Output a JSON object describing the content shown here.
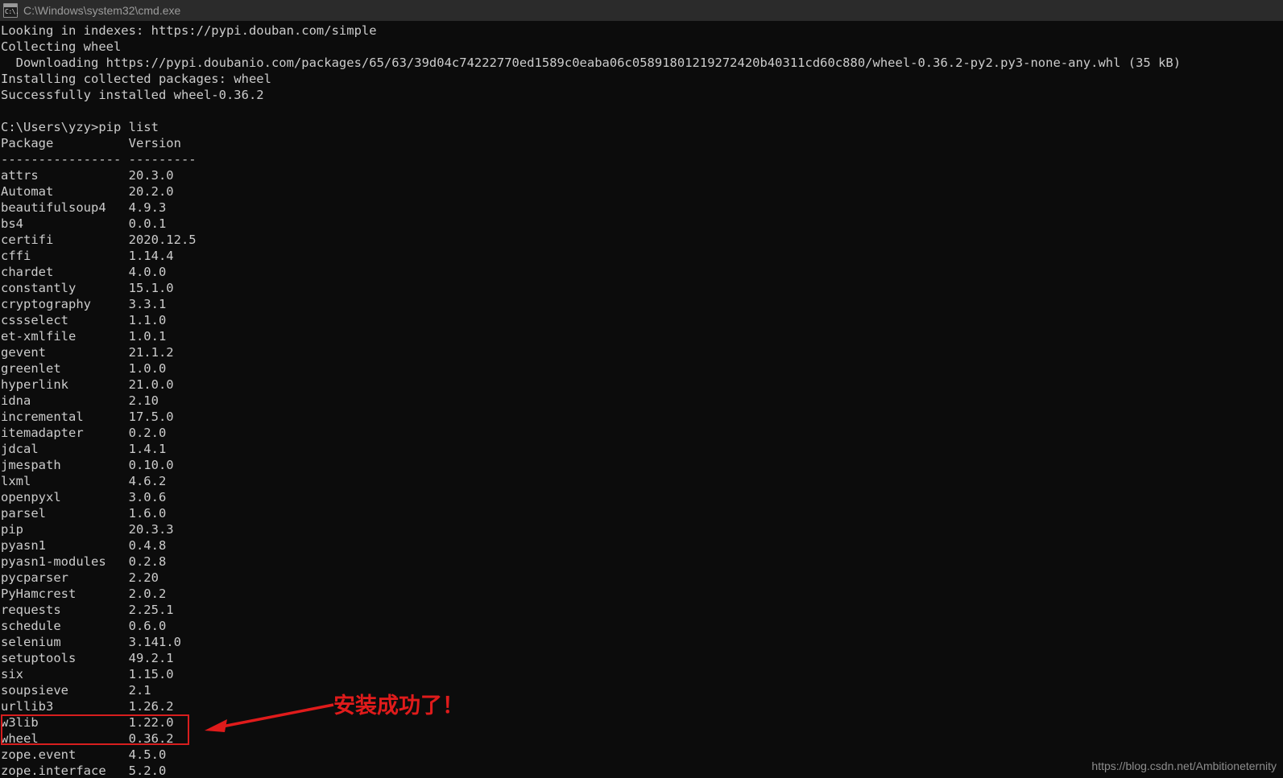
{
  "window": {
    "title": "C:\\Windows\\system32\\cmd.exe",
    "icon_name": "cmd-console-icon",
    "icon_glyph": "C:\\.",
    "titlebar_color": "#2b2b2b",
    "background_color": "#0c0c0c",
    "text_color": "#cccccc"
  },
  "terminal": {
    "install_output": [
      "Looking in indexes: https://pypi.douban.com/simple",
      "Collecting wheel",
      "  Downloading https://pypi.doubanio.com/packages/65/63/39d04c74222770ed1589c0eaba06c05891801219272420b40311cd60c880/wheel-0.36.2-py2.py3-none-any.whl (35 kB)",
      "Installing collected packages: wheel",
      "Successfully installed wheel-0.36.2"
    ],
    "prompt_line": "C:\\Users\\yzy>pip list",
    "header_line": "Package          Version",
    "separator_line": "---------------- ---------",
    "columns": [
      "Package",
      "Version"
    ],
    "packages": [
      {
        "name": "attrs",
        "version": "20.3.0"
      },
      {
        "name": "Automat",
        "version": "20.2.0"
      },
      {
        "name": "beautifulsoup4",
        "version": "4.9.3"
      },
      {
        "name": "bs4",
        "version": "0.0.1"
      },
      {
        "name": "certifi",
        "version": "2020.12.5"
      },
      {
        "name": "cffi",
        "version": "1.14.4"
      },
      {
        "name": "chardet",
        "version": "4.0.0"
      },
      {
        "name": "constantly",
        "version": "15.1.0"
      },
      {
        "name": "cryptography",
        "version": "3.3.1"
      },
      {
        "name": "cssselect",
        "version": "1.1.0"
      },
      {
        "name": "et-xmlfile",
        "version": "1.0.1"
      },
      {
        "name": "gevent",
        "version": "21.1.2"
      },
      {
        "name": "greenlet",
        "version": "1.0.0"
      },
      {
        "name": "hyperlink",
        "version": "21.0.0"
      },
      {
        "name": "idna",
        "version": "2.10"
      },
      {
        "name": "incremental",
        "version": "17.5.0"
      },
      {
        "name": "itemadapter",
        "version": "0.2.0"
      },
      {
        "name": "jdcal",
        "version": "1.4.1"
      },
      {
        "name": "jmespath",
        "version": "0.10.0"
      },
      {
        "name": "lxml",
        "version": "4.6.2"
      },
      {
        "name": "openpyxl",
        "version": "3.0.6"
      },
      {
        "name": "parsel",
        "version": "1.6.0"
      },
      {
        "name": "pip",
        "version": "20.3.3"
      },
      {
        "name": "pyasn1",
        "version": "0.4.8"
      },
      {
        "name": "pyasn1-modules",
        "version": "0.2.8"
      },
      {
        "name": "pycparser",
        "version": "2.20"
      },
      {
        "name": "PyHamcrest",
        "version": "2.0.2"
      },
      {
        "name": "requests",
        "version": "2.25.1"
      },
      {
        "name": "schedule",
        "version": "0.6.0"
      },
      {
        "name": "selenium",
        "version": "3.141.0"
      },
      {
        "name": "setuptools",
        "version": "49.2.1"
      },
      {
        "name": "six",
        "version": "1.15.0"
      },
      {
        "name": "soupsieve",
        "version": "2.1"
      },
      {
        "name": "urllib3",
        "version": "1.26.2"
      },
      {
        "name": "w3lib",
        "version": "1.22.0"
      },
      {
        "name": "wheel",
        "version": "0.36.2"
      },
      {
        "name": "zope.event",
        "version": "4.5.0"
      },
      {
        "name": "zope.interface",
        "version": "5.2.0"
      }
    ]
  },
  "annotation": {
    "text": "安装成功了！",
    "color": "#e01b1b",
    "highlight_rows": [
      "w3lib",
      "wheel"
    ],
    "arrow_direction": "left"
  },
  "watermark": {
    "text": "https://blog.csdn.net/Ambitioneternity"
  }
}
